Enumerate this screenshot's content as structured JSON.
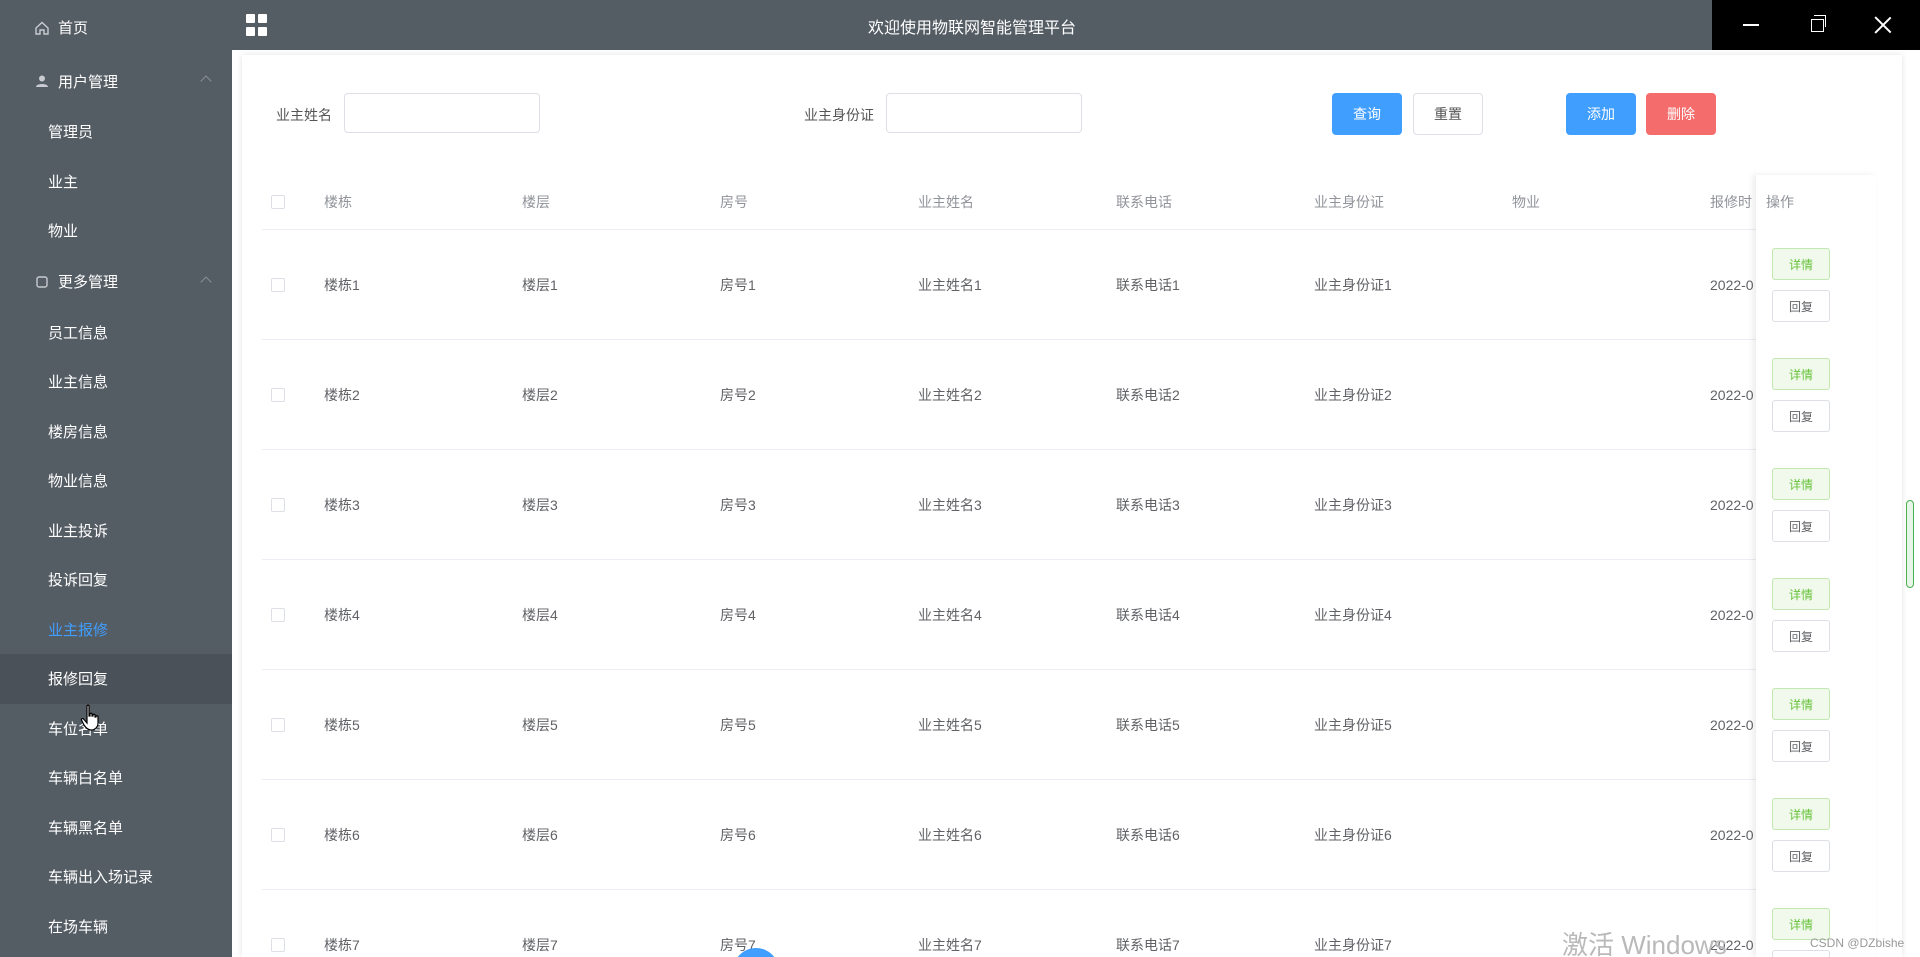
{
  "window": {
    "title": "欢迎使用物联网智能管理平台"
  },
  "sidebar": {
    "home": "首页",
    "user_group": "用户管理",
    "user_items": [
      "管理员",
      "业主",
      "物业"
    ],
    "more_group": "更多管理",
    "more_items": [
      "员工信息",
      "业主信息",
      "楼房信息",
      "物业信息",
      "业主投诉",
      "投诉回复",
      "业主报修",
      "报修回复",
      "车位名单",
      "车辆白名单",
      "车辆黑名单",
      "车辆出入场记录",
      "在场车辆"
    ],
    "active_item": "业主报修",
    "hover_item": "报修回复",
    "colors": {
      "bg": "#545c64",
      "active": "#409eff"
    }
  },
  "search": {
    "name_label": "业主姓名",
    "name_value": "",
    "id_label": "业主身份证",
    "id_value": "",
    "query_label": "查询",
    "reset_label": "重置",
    "add_label": "添加",
    "delete_label": "删除"
  },
  "table": {
    "columns": [
      "楼栋",
      "楼层",
      "房号",
      "业主姓名",
      "联系电话",
      "业主身份证",
      "物业",
      "报修时"
    ],
    "op_column": "操作",
    "detail_label": "详情",
    "reply_label": "回复",
    "rows": [
      [
        "楼栋1",
        "楼层1",
        "房号1",
        "业主姓名1",
        "联系电话1",
        "业主身份证1",
        "",
        "2022-0"
      ],
      [
        "楼栋2",
        "楼层2",
        "房号2",
        "业主姓名2",
        "联系电话2",
        "业主身份证2",
        "",
        "2022-0"
      ],
      [
        "楼栋3",
        "楼层3",
        "房号3",
        "业主姓名3",
        "联系电话3",
        "业主身份证3",
        "",
        "2022-0"
      ],
      [
        "楼栋4",
        "楼层4",
        "房号4",
        "业主姓名4",
        "联系电话4",
        "业主身份证4",
        "",
        "2022-0"
      ],
      [
        "楼栋5",
        "楼层5",
        "房号5",
        "业主姓名5",
        "联系电话5",
        "业主身份证5",
        "",
        "2022-0"
      ],
      [
        "楼栋6",
        "楼层6",
        "房号6",
        "业主姓名6",
        "联系电话6",
        "业主身份证6",
        "",
        "2022-0"
      ],
      [
        "楼栋7",
        "楼层7",
        "房号7",
        "业主姓名7",
        "联系电话7",
        "业主身份证7",
        "",
        "2022-0"
      ]
    ]
  },
  "overlay": {
    "watermark": "激活 Windows",
    "csdn": "CSDN @DZbishe"
  }
}
